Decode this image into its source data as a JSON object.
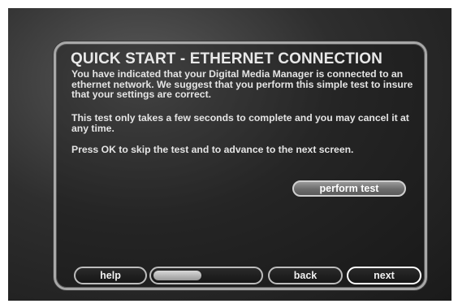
{
  "screen": {
    "title": "QUICK START - ETHERNET CONNECTION",
    "paragraphs": [
      "You have indicated that your Digital Media Manager is connected to an ethernet network. We suggest that you perform this simple test to insure that your settings are correct.",
      "This test only takes a few seconds to complete and you may cancel it at any time.",
      "Press OK to skip the test and to advance to the next screen."
    ]
  },
  "buttons": {
    "perform_test": "perform test",
    "help": "help",
    "back": "back",
    "next": "next"
  },
  "progress": {
    "fraction": 0.45
  },
  "colors": {
    "background": "#2e2e2e",
    "text": "#e4e4e4",
    "border": "#a8a8a8"
  }
}
